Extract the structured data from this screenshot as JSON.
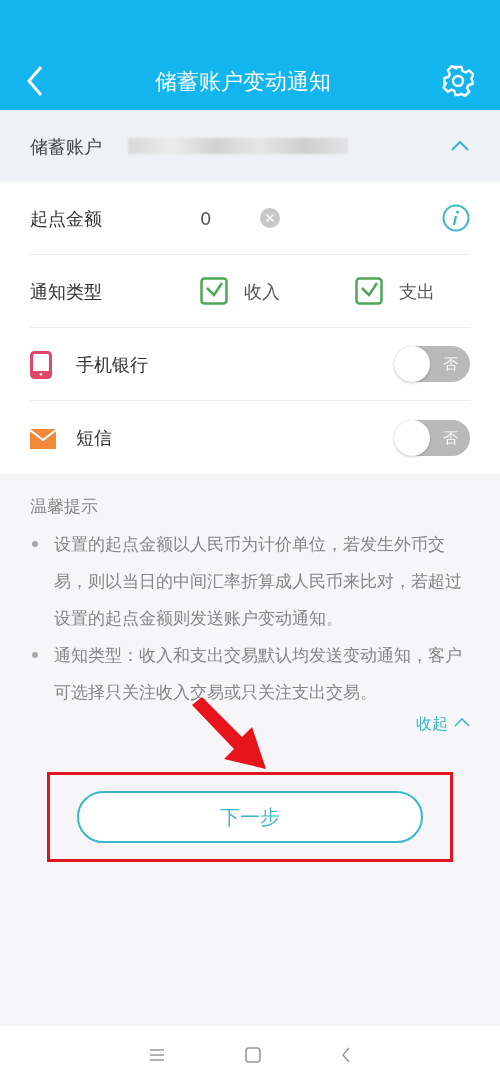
{
  "header": {
    "title": "储蓄账户变动通知"
  },
  "account": {
    "label": "储蓄账户",
    "expanded": true
  },
  "amount": {
    "label": "起点金额",
    "value": "0"
  },
  "notify_type": {
    "label": "通知类型",
    "options": [
      {
        "label": "收入",
        "checked": true
      },
      {
        "label": "支出",
        "checked": true
      }
    ]
  },
  "channels": [
    {
      "kind": "phone",
      "label": "手机银行",
      "on": false,
      "state_text": "否"
    },
    {
      "kind": "sms",
      "label": "短信",
      "on": false,
      "state_text": "否"
    }
  ],
  "tips": {
    "title": "温馨提示",
    "items": [
      "设置的起点金额以人民币为计价单位，若发生外币交易，则以当日的中间汇率折算成人民币来比对，若超过设置的起点金额则发送账户变动通知。",
      "通知类型：收入和支出交易默认均发送变动通知，客户可选择只关注收入交易或只关注支出交易。"
    ],
    "collapse_label": "收起"
  },
  "next_button": "下一步"
}
